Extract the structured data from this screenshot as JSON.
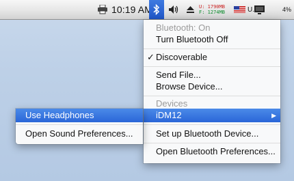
{
  "menubar": {
    "clock": "10:19 AM",
    "memory_used": "U: 1790MB",
    "memory_free": "F: 1274MB",
    "input_source": "U.S.",
    "battery_partial": "4%"
  },
  "bluetooth_menu": {
    "status": "Bluetooth: On",
    "toggle": "Turn Bluetooth Off",
    "check_mark": "✓",
    "discoverable": "Discoverable",
    "send_file": "Send File...",
    "browse_device": "Browse Device...",
    "devices_header": "Devices",
    "device_name": "iDM12",
    "submenu_arrow": "▶",
    "setup_device": "Set up Bluetooth Device...",
    "open_prefs": "Open Bluetooth Preferences..."
  },
  "device_submenu": {
    "use_headphones": "Use Headphones",
    "sound_prefs": "Open Sound Preferences..."
  },
  "colors": {
    "highlight": "#2a66d8",
    "memory_used": "#cc2222",
    "memory_free": "#0a8a2a"
  }
}
